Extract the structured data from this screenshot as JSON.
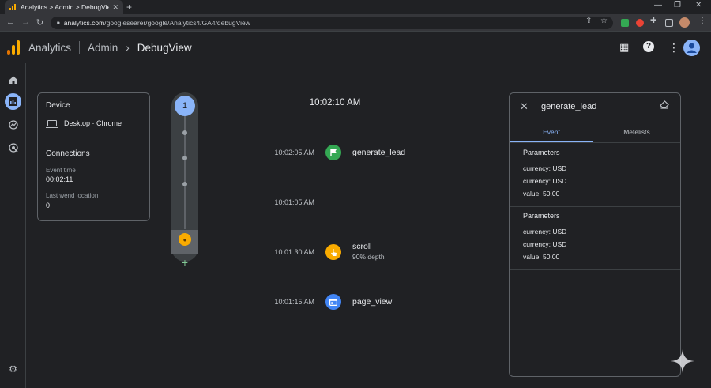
{
  "browser": {
    "tab_title": "Analytics > Admin > DebugView",
    "url_host": "analytics.com",
    "url_path": "/googlesearer/google/Analytics4/GA4/debugView"
  },
  "header": {
    "product": "Analytics",
    "crumb_1": "Admin",
    "crumb_2": "DebugView"
  },
  "device_card": {
    "device_title": "Device",
    "device_name": "Desktop · Chrome",
    "connections_title": "Connections",
    "event_time_label": "Event time",
    "event_time_value": "00:02:11",
    "last_location_label": "Last wend location",
    "last_location_value": "0"
  },
  "minutes": {
    "current_badge": "1"
  },
  "stream": {
    "header_time": "10:02:10 AM",
    "events": [
      {
        "time": "10:02:05 AM",
        "name": "generate_lead",
        "sub": "",
        "color": "#34a853",
        "icon": "flag-icon"
      },
      {
        "time": "10:01:05 AM",
        "name": "",
        "sub": "",
        "color": "",
        "icon": ""
      },
      {
        "time": "10:01:30 AM",
        "name": "scroll",
        "sub": "90% depth",
        "color": "#f9ab00",
        "icon": "pointer-icon"
      },
      {
        "time": "10:01:15 AM",
        "name": "page_view",
        "sub": "",
        "color": "#4285f4",
        "icon": "window-icon"
      }
    ]
  },
  "detail": {
    "title": "generate_lead",
    "tab_event": "Event",
    "tab_metelists": "Metelists",
    "groups": [
      {
        "heading": "Parameters",
        "rows": [
          "currency: USD",
          "currency: USD",
          "value: 50.00"
        ]
      },
      {
        "heading": "Parameters",
        "rows": [
          "currency: USD",
          "currency: USD",
          "value: 50.00"
        ]
      }
    ]
  },
  "colors": {
    "accent": "#8ab4f8",
    "ga_orange": "#f9ab00",
    "ga_dark_orange": "#e37400",
    "event_green": "#34a853",
    "event_yellow": "#f9ab00",
    "event_blue": "#4285f4"
  }
}
